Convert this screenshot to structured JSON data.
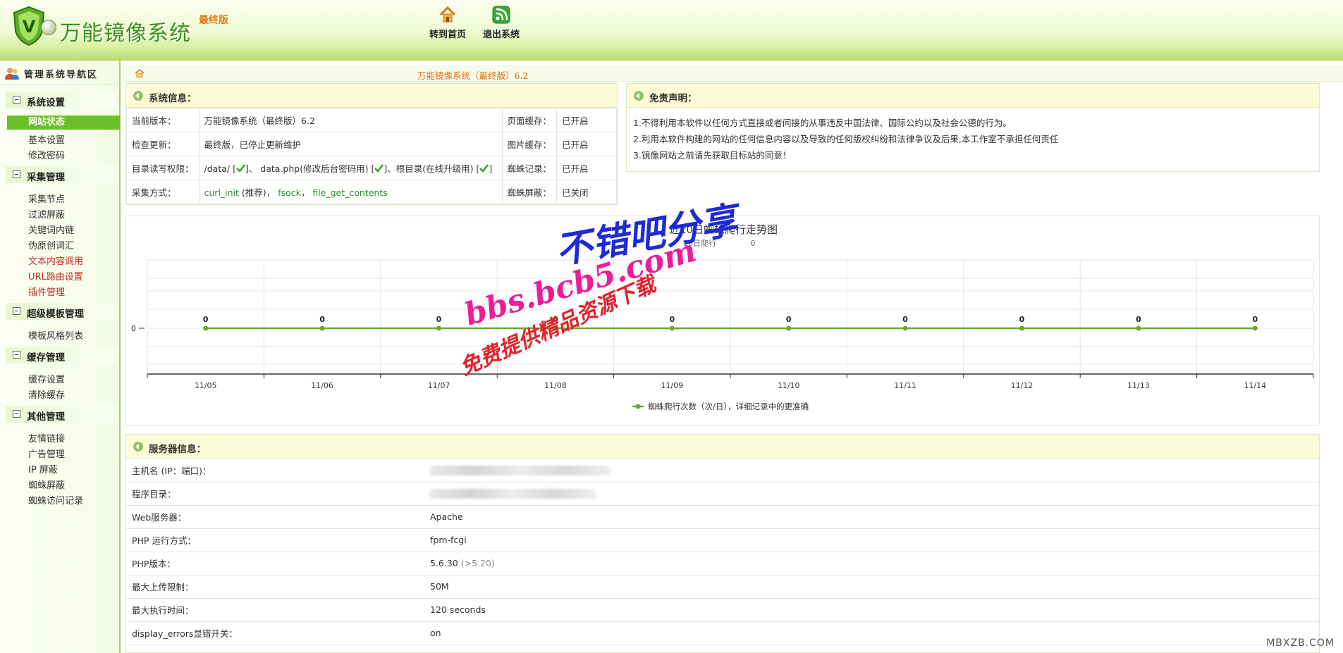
{
  "header": {
    "title": "万能镜像系统",
    "edition": "最终版",
    "nav": [
      {
        "label": "转到首页",
        "icon": "home-icon"
      },
      {
        "label": "退出系统",
        "icon": "rss-exit-icon"
      }
    ]
  },
  "sidebar": {
    "heading": "管理系统导航区",
    "sections": [
      {
        "title": "系统设置",
        "items": [
          "网站状态",
          "基本设置",
          "修改密码"
        ]
      },
      {
        "title": "采集管理",
        "items": [
          "采集节点",
          "过滤屏蔽",
          "关键词内链",
          "伪原创词汇",
          "文本内容调用",
          "URL路由设置",
          "插件管理"
        ]
      },
      {
        "title": "超级模板管理",
        "items": [
          "模板风格列表"
        ]
      },
      {
        "title": "缓存管理",
        "items": [
          "缓存设置",
          "清除缓存"
        ]
      },
      {
        "title": "其他管理",
        "items": [
          "友情链接",
          "广告管理",
          "IP 屏蔽",
          "蜘蛛屏蔽",
          "蜘蛛访问记录"
        ]
      }
    ]
  },
  "breadcrumb": {
    "text": "万能镜像系统（最终版）6.2"
  },
  "system_info": {
    "title": "系统信息：",
    "rows": {
      "version_label": "当前版本：",
      "version_value": "万能镜像系统（最终版）6.2",
      "page_cache_label": "页面缓存：",
      "page_cache_value": "已开启",
      "update_label": "检查更新：",
      "update_value": "最终版，已停止更新维护",
      "img_cache_label": "图片缓存：",
      "img_cache_value": "已开启",
      "perm_label": "目录读写权限：",
      "perm_data": "/data/ [",
      "perm_sep1": "]、 data.php(修改后台密码用) [",
      "perm_sep2": "]、根目录(在线升级用) [",
      "perm_end": "]",
      "spider_log_label": "蜘蛛记录：",
      "spider_log_value": "已开启",
      "collect_label": "采集方式：",
      "collect_curl": "curl_init",
      "collect_rec": " (推荐)， ",
      "collect_fsock": "fsock",
      "collect_comma": "， ",
      "collect_fgc": "file_get_contents",
      "spider_block_label": "蜘蛛屏蔽：",
      "spider_block_value": "已关闭"
    }
  },
  "disclaimer": {
    "title": "免责声明：",
    "lines": [
      "1.不得利用本软件以任何方式直接或者间接的从事违反中国法律、国际公约以及社会公德的行为。",
      "2.利用本软件构建的网站的任何信息内容以及导致的任何版权纠纷和法律争议及后果,本工作室不承担任何责任",
      "3.镜像网站之前请先获取目标站的同意！"
    ]
  },
  "chart_data": {
    "type": "line",
    "title": "近10日蜘蛛爬行走势图",
    "subtitle": "10日爬行",
    "subtitle_tail": "0",
    "categories": [
      "11/05",
      "11/06",
      "11/07",
      "11/08",
      "11/09",
      "11/10",
      "11/11",
      "11/12",
      "11/13",
      "11/14"
    ],
    "series": [
      {
        "name": "蜘蛛爬行次数（次/日），详细记录中的更准确",
        "values": [
          0,
          0,
          0,
          0,
          0,
          0,
          0,
          0,
          0,
          0
        ]
      }
    ],
    "ytick": "0",
    "color": "#6aaa2a",
    "grid": true,
    "legend": "bottom"
  },
  "watermark": {
    "line1": "不错吧分享",
    "line2": "bbs.bcb5.com",
    "line3": "免费提供精品资源下载",
    "site": "MBXZB.COM"
  },
  "server_info": {
    "title": "服务器信息：",
    "rows": [
      {
        "label": "主机名 (IP：端口)：",
        "value": "",
        "blurred": true
      },
      {
        "label": "程序目录：",
        "value": "",
        "blurred": true
      },
      {
        "label": "Web服务器：",
        "value": "Apache"
      },
      {
        "label": "PHP 运行方式：",
        "value": "fpm-fcgi"
      },
      {
        "label": "PHP版本：",
        "value": "5.6.30",
        "note": "(>5.20)"
      },
      {
        "label": "最大上传限制：",
        "value": "50M"
      },
      {
        "label": "最大执行时间：",
        "value": "120 seconds"
      },
      {
        "label": "display_errors显错开关：",
        "value": "on"
      }
    ]
  },
  "colors": {
    "brand_green": "#3d8f1f",
    "accent_orange": "#e07b12",
    "active_bg": "#6bbf2a",
    "status_on": "#2e8b2e",
    "status_off": "#d0281e"
  }
}
